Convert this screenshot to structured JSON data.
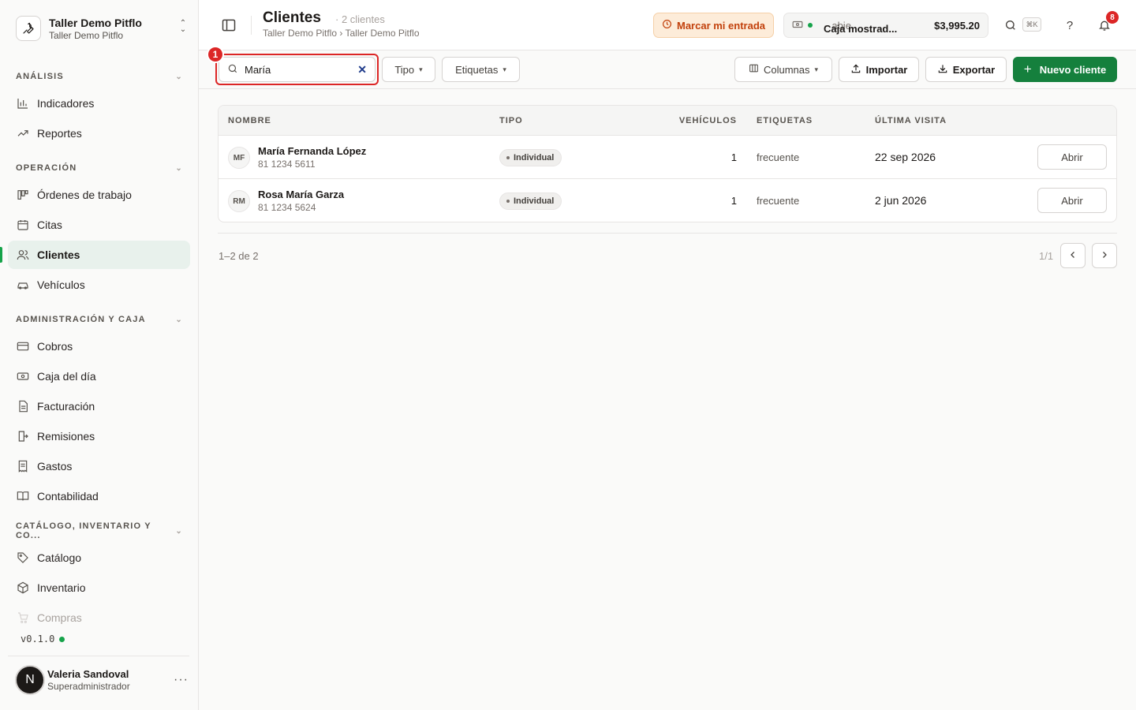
{
  "org": {
    "name": "Taller Demo Pitflo",
    "sub": "Taller Demo Pitflo"
  },
  "sidebar": {
    "groups": [
      {
        "label": "ANÁLISIS"
      },
      {
        "label": "OPERACIÓN"
      },
      {
        "label": "ADMINISTRACIÓN Y CAJA"
      },
      {
        "label": "CATÁLOGO, INVENTARIO Y CO..."
      }
    ],
    "items": [
      {
        "label": "Indicadores",
        "icon": "bar-chart-icon"
      },
      {
        "label": "Reportes",
        "icon": "trend-icon"
      },
      {
        "label": "Órdenes de trabajo",
        "icon": "kanban-icon"
      },
      {
        "label": "Citas",
        "icon": "calendar-icon"
      },
      {
        "label": "Clientes",
        "icon": "users-icon",
        "active": true
      },
      {
        "label": "Vehículos",
        "icon": "car-icon"
      },
      {
        "label": "Cobros",
        "icon": "card-icon"
      },
      {
        "label": "Caja del día",
        "icon": "cash-icon"
      },
      {
        "label": "Facturación",
        "icon": "invoice-icon"
      },
      {
        "label": "Remisiones",
        "icon": "remission-icon"
      },
      {
        "label": "Gastos",
        "icon": "receipt-icon"
      },
      {
        "label": "Contabilidad",
        "icon": "book-icon"
      },
      {
        "label": "Catálogo",
        "icon": "tag-icon"
      },
      {
        "label": "Inventario",
        "icon": "box-icon"
      },
      {
        "label": "Compras",
        "icon": "cart-icon"
      }
    ],
    "version": "v0.1.0",
    "user": {
      "initial": "N",
      "name": "Valeria Sandoval",
      "role": "Superadministrador"
    }
  },
  "header": {
    "title": "Clientes",
    "count": "· 2 clientes",
    "breadcrumb": "Taller Demo Pitflo › Taller Demo Pitflo",
    "entrada_label": "Marcar mi entrada",
    "caja": {
      "name": "Caja mostrad...",
      "sep": "·",
      "status": "abie",
      "amount": "$3,995.20"
    },
    "search_shortcut": "⌘K",
    "help": "?",
    "notifications": "8"
  },
  "toolbar": {
    "step_marker": "1",
    "search_value": "María",
    "filters": {
      "tipo": "Tipo",
      "etiquetas": "Etiquetas"
    },
    "columnas": "Columnas",
    "importar": "Importar",
    "exportar": "Exportar",
    "nuevo": "Nuevo cliente"
  },
  "table": {
    "headers": {
      "nombre": "NOMBRE",
      "tipo": "TIPO",
      "vehiculos": "VEHÍCULOS",
      "etiquetas": "ETIQUETAS",
      "ultima_visita": "ÚLTIMA VISITA"
    },
    "rows": [
      {
        "initials": "MF",
        "name": "María Fernanda López",
        "phone": "81 1234 5611",
        "tipo": "Individual",
        "vehiculos": "1",
        "etiquetas": "frecuente",
        "ultima_visita": "22 sep 2026",
        "action": "Abrir"
      },
      {
        "initials": "RM",
        "name": "Rosa María Garza",
        "phone": "81 1234 5624",
        "tipo": "Individual",
        "vehiculos": "1",
        "etiquetas": "frecuente",
        "ultima_visita": "2 jun 2026",
        "action": "Abrir"
      }
    ]
  },
  "pagination": {
    "info": "1–2 de 2",
    "page": "1/1"
  },
  "colors": {
    "accent": "#15803d",
    "danger": "#dc2626",
    "warning_bg": "#fdecd9",
    "active_bg": "#e8f1ec"
  }
}
